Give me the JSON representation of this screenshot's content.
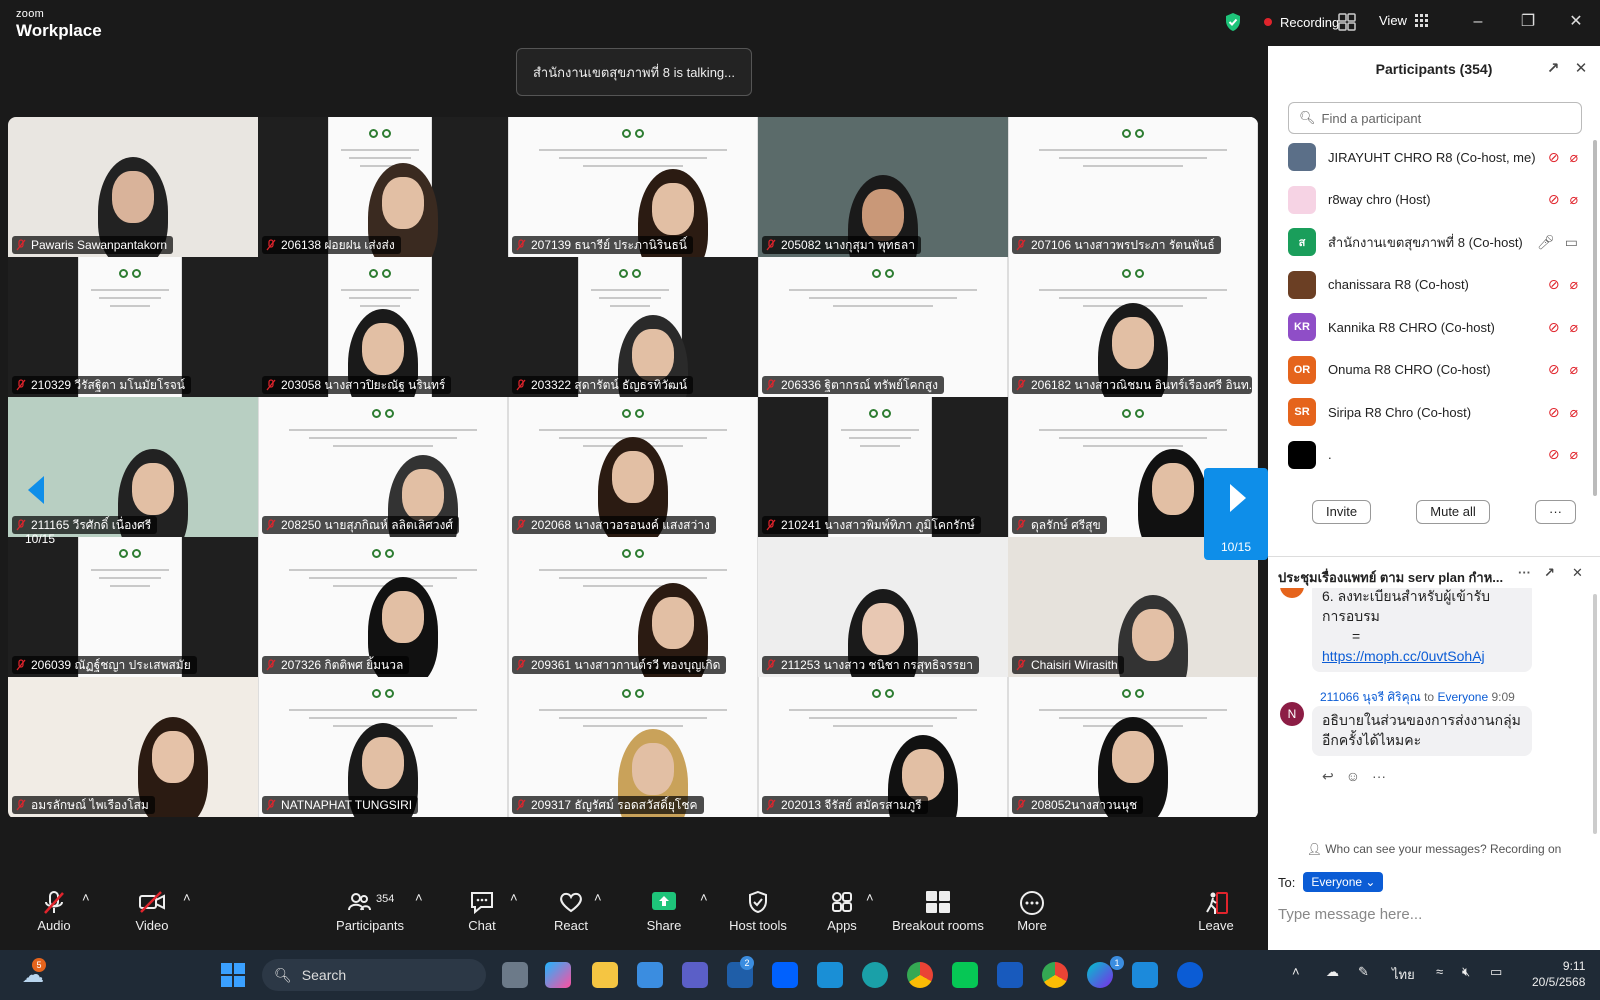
{
  "app": {
    "brand_top": "zoom",
    "brand_bottom": "Workplace",
    "recording_label": "Recording",
    "view_label": "View"
  },
  "talking_banner": "สำนักงานเขตสุขภาพที่ 8 is talking...",
  "tiles": [
    {
      "name": "Pawaris Sawanpantakorn"
    },
    {
      "name": "206138 ฝอยฝน เส่งส่ง"
    },
    {
      "name": "207139 ธนารีย์ ประภานิรินธนิ์"
    },
    {
      "name": "205082 นางกุสุมา พุทธลา"
    },
    {
      "name": "207106 นางสาวพรประภา รัตนพันธ์"
    },
    {
      "name": "210329 วีรัสฐิตา มโนมัยโรจน์"
    },
    {
      "name": "203058 นางสาวปิยะณัฐ นรินทร์"
    },
    {
      "name": "203322 สุดารัตน์ ธัญธรทิวัฒน์"
    },
    {
      "name": "206336 ฐิตากรณ์ ทรัพย์โคกสูง"
    },
    {
      "name": "206182 นางสาวณิชมน อินทร์เรืองศรี อินท..."
    },
    {
      "name": "211165 วีรศักดิ์ เนื่องศรี"
    },
    {
      "name": "208250 นายสุภกิณห์ ลลิตเลิศวงศ์"
    },
    {
      "name": "202068 นางสาวอรอนงค์ แสงสว่าง"
    },
    {
      "name": "210241 นางสาวพิมพ์ทิภา ภูมิโคกรักษ์"
    },
    {
      "name": "ดุลรักษ์ ศรีสุข"
    },
    {
      "name": "206039 ณัฏฐ์ชญา ประเสพสมัย"
    },
    {
      "name": "207326 กิตติพศ ยิ้มนวล"
    },
    {
      "name": "209361 นางสาวกานต์รวี ทองบุญเกิด"
    },
    {
      "name": "211253 นางสาว ชนิชา กรสุทธิจรรยา"
    },
    {
      "name": "Chaisiri Wirasith"
    },
    {
      "name": "อมรลักษณ์ ไพเรืองโสม"
    },
    {
      "name": "NATNAPHAT TUNGSIRI"
    },
    {
      "name": "209317 ธัญรัศม์ รอดสวัสดิ์ยุโชค"
    },
    {
      "name": "202013 จีรัสย์ สมัครสามภูรี"
    },
    {
      "name": "208052นางสาวนนุช"
    }
  ],
  "pager": {
    "left": "10/15",
    "right": "10/15"
  },
  "participants": {
    "title": "Participants (354)",
    "search_placeholder": "Find a participant",
    "list": [
      {
        "name": "JIRAYUHT CHRO R8 (Co-host, me)",
        "initials": "",
        "color": "#5b6f88"
      },
      {
        "name": "r8way chro (Host)",
        "initials": "",
        "color": "#f6d3e4"
      },
      {
        "name": "สำนักงานเขตสุขภาพที่ 8 (Co-host)",
        "initials": "ส",
        "color": "#1a9e5b"
      },
      {
        "name": "chanissara R8 (Co-host)",
        "initials": "",
        "color": "#6b3f24"
      },
      {
        "name": "Kannika R8 CHRO (Co-host)",
        "initials": "KR",
        "color": "#8f4ec7"
      },
      {
        "name": "Onuma R8 CHRO (Co-host)",
        "initials": "OR",
        "color": "#e5641c"
      },
      {
        "name": "Siripa R8 Chro (Co-host)",
        "initials": "SR",
        "color": "#e5641c"
      },
      {
        "name": ".",
        "initials": "",
        "color": "#000000"
      }
    ],
    "invite_label": "Invite",
    "mute_all_label": "Mute all",
    "more_label": "···"
  },
  "chat": {
    "title": "ประชุมเรื่องแพทย์ ตาม serv plan กำห...",
    "msg1_line1": "6. ลงทะเบียนสำหรับผู้เข้ารับ",
    "msg1_line2": "การอบรม",
    "msg1_line3": "=",
    "msg1_link": "https://moph.cc/0uvtSohAj",
    "msg2_sender": "211066 นุจรี ศิริคุณ",
    "msg2_to": "to",
    "msg2_recipient": "Everyone",
    "msg2_time": "9:09",
    "msg2_avatar": "N",
    "msg2_line1": "อธิบายในส่วนของการส่งงานกลุ่ม",
    "msg2_line2": "อีกครั้งได้ไหมคะ",
    "who_can_see": "Who can see your messages? Recording on",
    "to_label": "To:",
    "to_value": "Everyone",
    "placeholder": "Type message here..."
  },
  "toolbar": {
    "audio": "Audio",
    "video": "Video",
    "participants": "Participants",
    "participants_count": "354",
    "chat": "Chat",
    "react": "React",
    "share": "Share",
    "host_tools": "Host tools",
    "apps": "Apps",
    "breakout": "Breakout rooms",
    "more": "More",
    "leave": "Leave"
  },
  "taskbar": {
    "search": "Search",
    "weather_badge": "5",
    "teams_badge": "2",
    "canva_badge": "1",
    "lang": "ไทย",
    "time": "9:11",
    "date": "20/5/2568"
  },
  "colors": {
    "accent": "#0e8ee9",
    "record": "#e0242c",
    "share": "#1ec47a",
    "zoom_blue": "#0b5cd5"
  }
}
